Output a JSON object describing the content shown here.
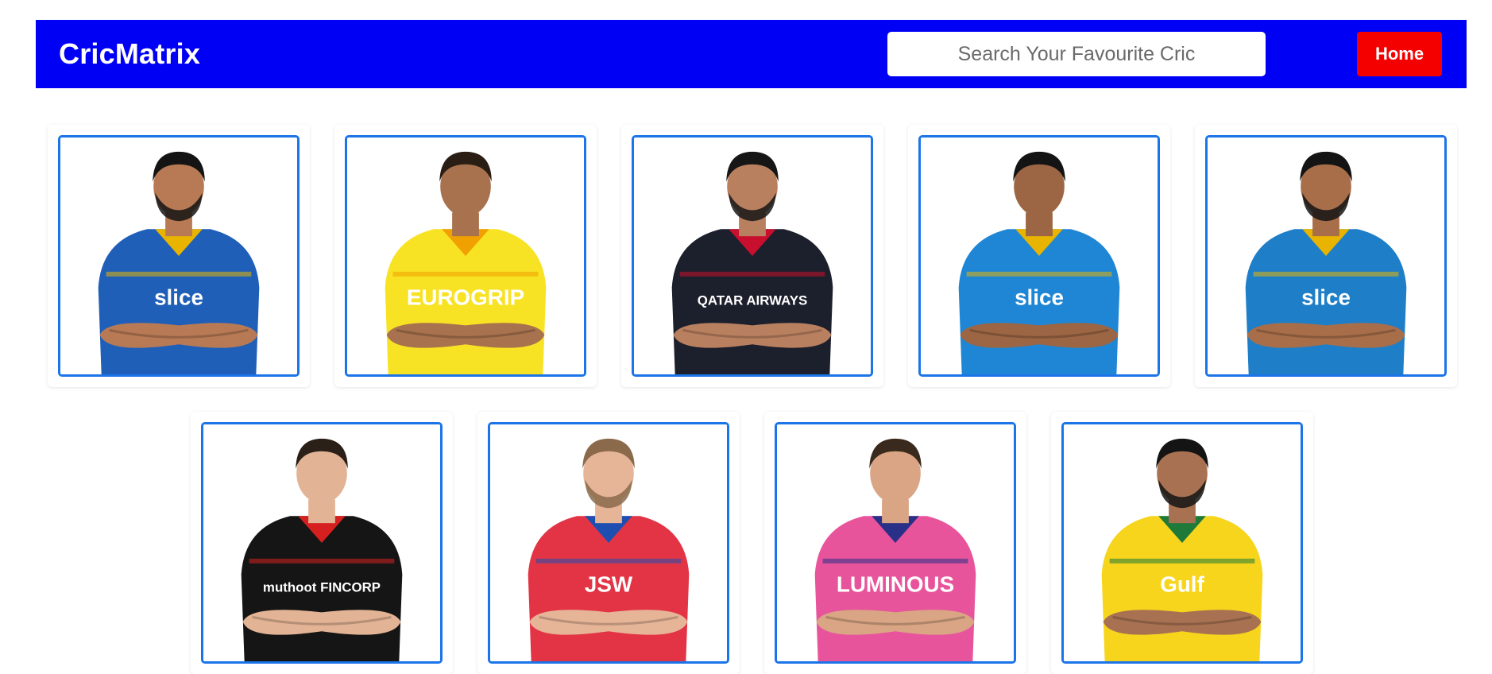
{
  "navbar": {
    "brand": "CricMatrix",
    "search_placeholder": "Search Your Favourite Cric",
    "home_label": "Home",
    "bg_color": "#0000f5",
    "home_color": "#f50000"
  },
  "players": [
    {
      "jersey": "#1f5fb8",
      "trim": "#e8b400",
      "skin": "#b87a55",
      "hair": "#141414",
      "beard": true,
      "sponsor": "slice"
    },
    {
      "jersey": "#f8e224",
      "trim": "#f0a000",
      "skin": "#a8724e",
      "hair": "#2a1e14",
      "beard": false,
      "sponsor": "EUROGRIP"
    },
    {
      "jersey": "#1c1f2c",
      "trim": "#c8102e",
      "skin": "#b98060",
      "hair": "#161616",
      "beard": true,
      "sponsor": "QATAR AIRWAYS"
    },
    {
      "jersey": "#1e86d4",
      "trim": "#e8b400",
      "skin": "#9c6644",
      "hair": "#141414",
      "beard": false,
      "sponsor": "slice"
    },
    {
      "jersey": "#1e7ec7",
      "trim": "#e8b400",
      "skin": "#a86e4a",
      "hair": "#141414",
      "beard": true,
      "sponsor": "slice"
    },
    {
      "jersey": "#151515",
      "trim": "#d62020",
      "skin": "#e2b394",
      "hair": "#2a2018",
      "beard": false,
      "sponsor": "muthoot FINCORP"
    },
    {
      "jersey": "#e33445",
      "trim": "#1e4fb0",
      "skin": "#e6b598",
      "hair": "#8a6a4a",
      "beard": true,
      "sponsor": "JSW"
    },
    {
      "jersey": "#e8549c",
      "trim": "#2a2f88",
      "skin": "#d9a584",
      "hair": "#3a2a1e",
      "beard": false,
      "sponsor": "LUMINOUS"
    },
    {
      "jersey": "#f7d51c",
      "trim": "#1f7a3a",
      "skin": "#a87252",
      "hair": "#141414",
      "beard": true,
      "sponsor": "Gulf"
    }
  ]
}
